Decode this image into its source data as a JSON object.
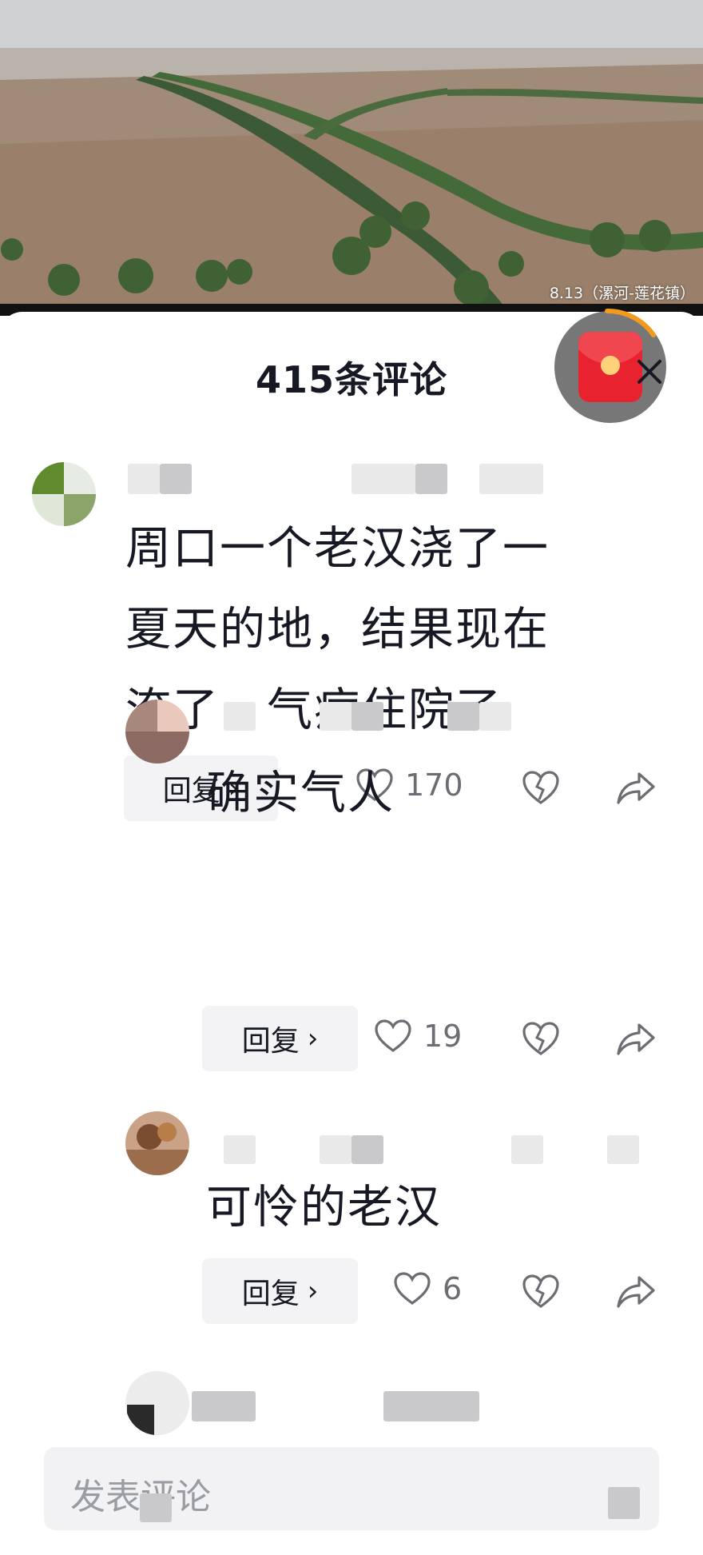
{
  "video": {
    "caption": "8.13（漯河-莲花镇）"
  },
  "comments_panel": {
    "title": "415条评论",
    "comments": [
      {
        "text_lines": [
          "周口一个老汉浇了一",
          "夏天的地，结果现在",
          "淹了，气病住院了"
        ],
        "reply_label": "回复",
        "likes": "170"
      },
      {
        "text": "确实气人",
        "reply_label": "回复",
        "likes": "19"
      },
      {
        "text": "可怜的老汉",
        "reply_label": "回复",
        "likes": "6"
      }
    ],
    "input_placeholder": "发表评论"
  },
  "colors": {
    "accent_red": "#e8232f",
    "progress_orange": "#f39a1c"
  },
  "icons": [
    "heart-icon",
    "dislike-heart-icon",
    "share-arrow-icon",
    "close-icon",
    "red-envelope-icon"
  ]
}
